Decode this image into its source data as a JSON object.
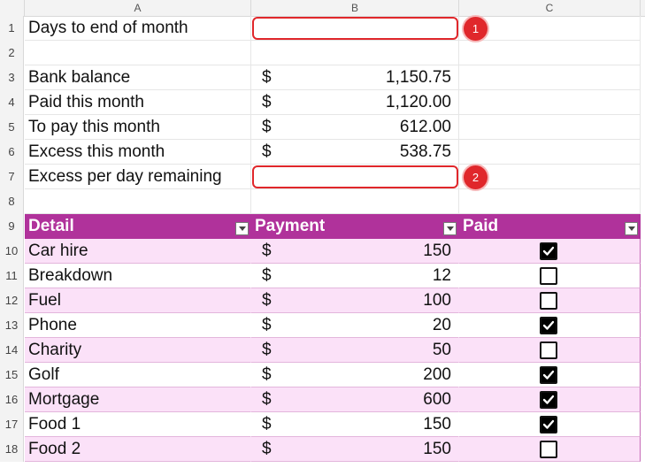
{
  "columns": [
    "A",
    "B",
    "C"
  ],
  "rows_top": [
    {
      "num": "1",
      "a": "Days to end of month",
      "currency": "",
      "amount": ""
    },
    {
      "num": "2",
      "a": "",
      "currency": "",
      "amount": ""
    },
    {
      "num": "3",
      "a": "Bank balance",
      "currency": "$",
      "amount": "1,150.75"
    },
    {
      "num": "4",
      "a": "Paid this month",
      "currency": "$",
      "amount": "1,120.00"
    },
    {
      "num": "5",
      "a": "To pay this month",
      "currency": "$",
      "amount": "612.00"
    },
    {
      "num": "6",
      "a": "Excess this month",
      "currency": "$",
      "amount": "538.75"
    },
    {
      "num": "7",
      "a": "Excess per day remaining",
      "currency": "",
      "amount": ""
    },
    {
      "num": "8",
      "a": "",
      "currency": "",
      "amount": ""
    }
  ],
  "table": {
    "header_row_num": "9",
    "headers": [
      "Detail",
      "Payment",
      "Paid"
    ],
    "accent_color": "#b0329b",
    "band_color": "#fbe1f8",
    "rows": [
      {
        "num": "10",
        "detail": "Car hire",
        "currency": "$",
        "payment": "150",
        "paid": true
      },
      {
        "num": "11",
        "detail": "Breakdown",
        "currency": "$",
        "payment": "12",
        "paid": false
      },
      {
        "num": "12",
        "detail": "Fuel",
        "currency": "$",
        "payment": "100",
        "paid": false
      },
      {
        "num": "13",
        "detail": "Phone",
        "currency": "$",
        "payment": "20",
        "paid": true
      },
      {
        "num": "14",
        "detail": "Charity",
        "currency": "$",
        "payment": "50",
        "paid": false
      },
      {
        "num": "15",
        "detail": "Golf",
        "currency": "$",
        "payment": "200",
        "paid": true
      },
      {
        "num": "16",
        "detail": "Mortgage",
        "currency": "$",
        "payment": "600",
        "paid": true
      },
      {
        "num": "17",
        "detail": "Food 1",
        "currency": "$",
        "payment": "150",
        "paid": true
      },
      {
        "num": "18",
        "detail": "Food 2",
        "currency": "$",
        "payment": "150",
        "paid": false
      }
    ]
  },
  "annotations": [
    {
      "label": "1",
      "row": "1",
      "color": "#e0272b"
    },
    {
      "label": "2",
      "row": "7",
      "color": "#e0272b"
    }
  ]
}
